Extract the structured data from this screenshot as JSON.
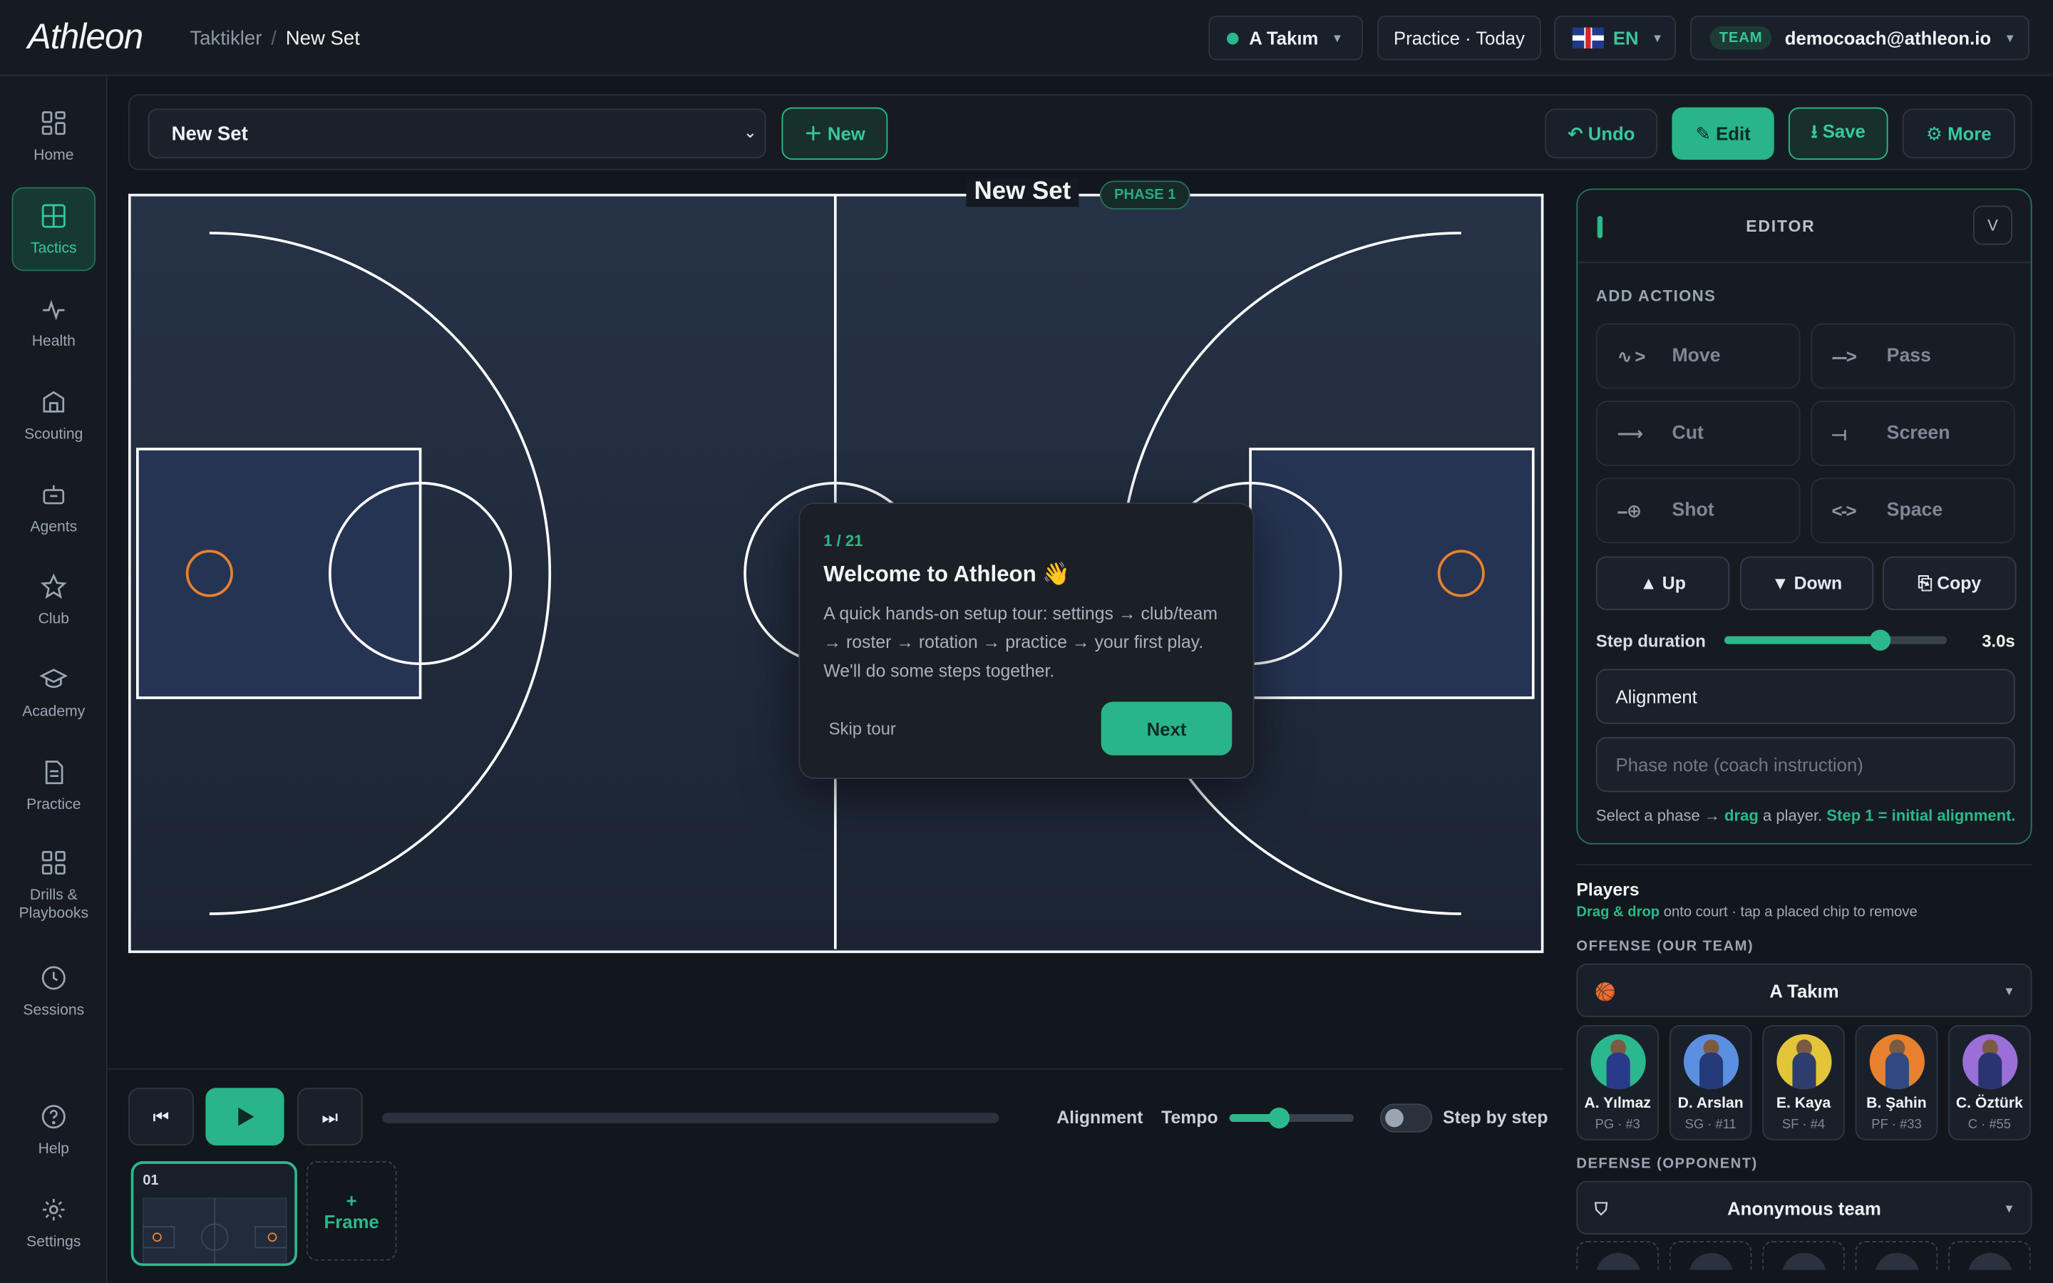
{
  "app": {
    "logo": "Athleon"
  },
  "breadcrumb": {
    "parent": "Taktikler",
    "separator": "/",
    "current": "New Set"
  },
  "topbar": {
    "team": "A Takım",
    "practice": "Practice · Today",
    "language": "EN",
    "account_badge": "TEAM",
    "account_email": "democoach@athleon.io"
  },
  "sidebar": {
    "items": [
      {
        "label": "Home",
        "icon": "home-icon"
      },
      {
        "label": "Tactics",
        "icon": "tactics-icon",
        "active": true
      },
      {
        "label": "Health",
        "icon": "pulse-icon"
      },
      {
        "label": "Scouting",
        "icon": "building-icon"
      },
      {
        "label": "Agents",
        "icon": "robot-icon"
      },
      {
        "label": "Club",
        "icon": "star-icon"
      },
      {
        "label": "Academy",
        "icon": "graduation-cap-icon"
      },
      {
        "label": "Practice",
        "icon": "document-icon"
      },
      {
        "label": "Drills &\nPlaybooks",
        "icon": "grid-icon"
      },
      {
        "label": "Sessions",
        "icon": "clock-icon"
      },
      {
        "label": "Help",
        "icon": "help-icon"
      },
      {
        "label": "Settings",
        "icon": "gear-icon"
      }
    ]
  },
  "toolbar": {
    "set_name": "New Set",
    "new_label": "＋ New",
    "undo_label": "↶ Undo",
    "edit_label": "✎ Edit",
    "save_label": "⭳ Save",
    "more_label": "⚙ More"
  },
  "court": {
    "title": "New Set",
    "phase": "PHASE 1"
  },
  "tour": {
    "step": "1 / 21",
    "title": "Welcome to Athleon 👋",
    "body": "A quick hands-on setup tour: settings → club/team → roster → rotation → practice → your first play. We'll do some steps together.",
    "skip": "Skip tour",
    "next": "Next"
  },
  "transport": {
    "progress": 0.0,
    "alignment_label": "Alignment",
    "tempo_label": "Tempo",
    "tempo_value": 0.4,
    "step_by_step_label": "Step by step",
    "step_by_step_on": false,
    "frame_number": "01",
    "add_frame_plus": "+",
    "add_frame_label": "Frame"
  },
  "editor": {
    "title": "EDITOR",
    "toggle_label": "V",
    "add_actions_label": "ADD ACTIONS",
    "actions": [
      {
        "label": "Move",
        "icon": "∿ >"
      },
      {
        "label": "Pass",
        "icon": "--->"
      },
      {
        "label": "Cut",
        "icon": "⟶"
      },
      {
        "label": "Screen",
        "icon": "⟞"
      },
      {
        "label": "Shot",
        "icon": "--⊕"
      },
      {
        "label": "Space",
        "icon": "<->"
      }
    ],
    "up_label": "▲ Up",
    "down_label": "▼ Down",
    "copy_label": "⎘ Copy",
    "step_duration_label": "Step duration",
    "step_duration_value": "3.0s",
    "step_duration_fraction": 0.7,
    "alignment_value": "Alignment",
    "phase_note_placeholder": "Phase note (coach instruction)",
    "hint_pre": "Select a phase → ",
    "hint_drag": "drag",
    "hint_mid": " a player. ",
    "hint_step": "Step 1 = initial alignment."
  },
  "players": {
    "title": "Players",
    "subtitle_em": "Drag & drop",
    "subtitle_rest": " onto court · tap a placed chip to remove",
    "offense_label": "OFFENSE (OUR TEAM)",
    "offense_team": "A Takım",
    "defense_label": "DEFENSE (OPPONENT)",
    "defense_team": "Anonymous team",
    "roster": [
      {
        "name": "A. Yılmaz",
        "pos": "PG · #3",
        "bg": "#2bb88f",
        "jersey": "#2a3a8a"
      },
      {
        "name": "D. Arslan",
        "pos": "SG · #11",
        "bg": "#5b8fe0",
        "jersey": "#243a7a"
      },
      {
        "name": "E. Kaya",
        "pos": "SF · #4",
        "bg": "#e3c53a",
        "jersey": "#2d3e6e"
      },
      {
        "name": "B. Şahin",
        "pos": "PF · #33",
        "bg": "#e8812d",
        "jersey": "#304a80"
      },
      {
        "name": "C. Öztürk",
        "pos": "C · #55",
        "bg": "#9b6fd8",
        "jersey": "#2a3570"
      }
    ]
  },
  "colors": {
    "accent": "#2bb88f",
    "hoop": "#e8812d",
    "court": "#222c3e"
  }
}
